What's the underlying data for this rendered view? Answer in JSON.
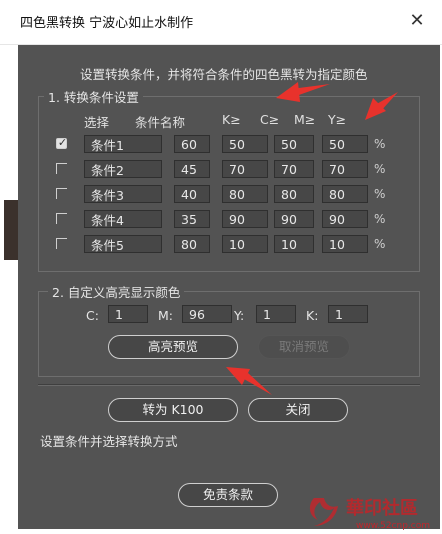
{
  "window": {
    "title": "四色黑转换 宁波心如止水制作",
    "close_glyph": "✕"
  },
  "instruction": "设置转换条件，并将符合条件的四色黑转为指定颜色",
  "group1": {
    "legend": "1. 转换条件设置",
    "headers": {
      "select": "选择",
      "name": "条件名称",
      "k": "K≥",
      "c": "C≥",
      "m": "M≥",
      "y": "Y≥"
    },
    "percent": "%",
    "rows": [
      {
        "checked": true,
        "name": "条件1",
        "k": "60",
        "c": "50",
        "m": "50",
        "y": "50"
      },
      {
        "checked": false,
        "name": "条件2",
        "k": "45",
        "c": "70",
        "m": "70",
        "y": "70"
      },
      {
        "checked": false,
        "name": "条件3",
        "k": "40",
        "c": "80",
        "m": "80",
        "y": "80"
      },
      {
        "checked": false,
        "name": "条件4",
        "k": "35",
        "c": "90",
        "m": "90",
        "y": "90"
      },
      {
        "checked": false,
        "name": "条件5",
        "k": "80",
        "c": "10",
        "m": "10",
        "y": "10"
      }
    ]
  },
  "group2": {
    "legend": "2. 自定义高亮显示颜色",
    "c_label": "C:",
    "c_value": "1",
    "m_label": "M:",
    "m_value": "96",
    "y_label": "Y:",
    "y_value": "1",
    "k_label": "K:",
    "k_value": "1",
    "preview_button": "高亮预览",
    "cancel_preview_button": "取消预览"
  },
  "actions": {
    "convert_button": "转为 K100",
    "close_button": "关闭"
  },
  "status": "设置条件并选择转换方式",
  "disclaimer_button": "免责条款",
  "watermark": {
    "text": "華印社區",
    "url": "www.52cnp.com"
  },
  "colors": {
    "panel": "#535353",
    "field": "#474747",
    "annotation_red": "#e8322c"
  }
}
